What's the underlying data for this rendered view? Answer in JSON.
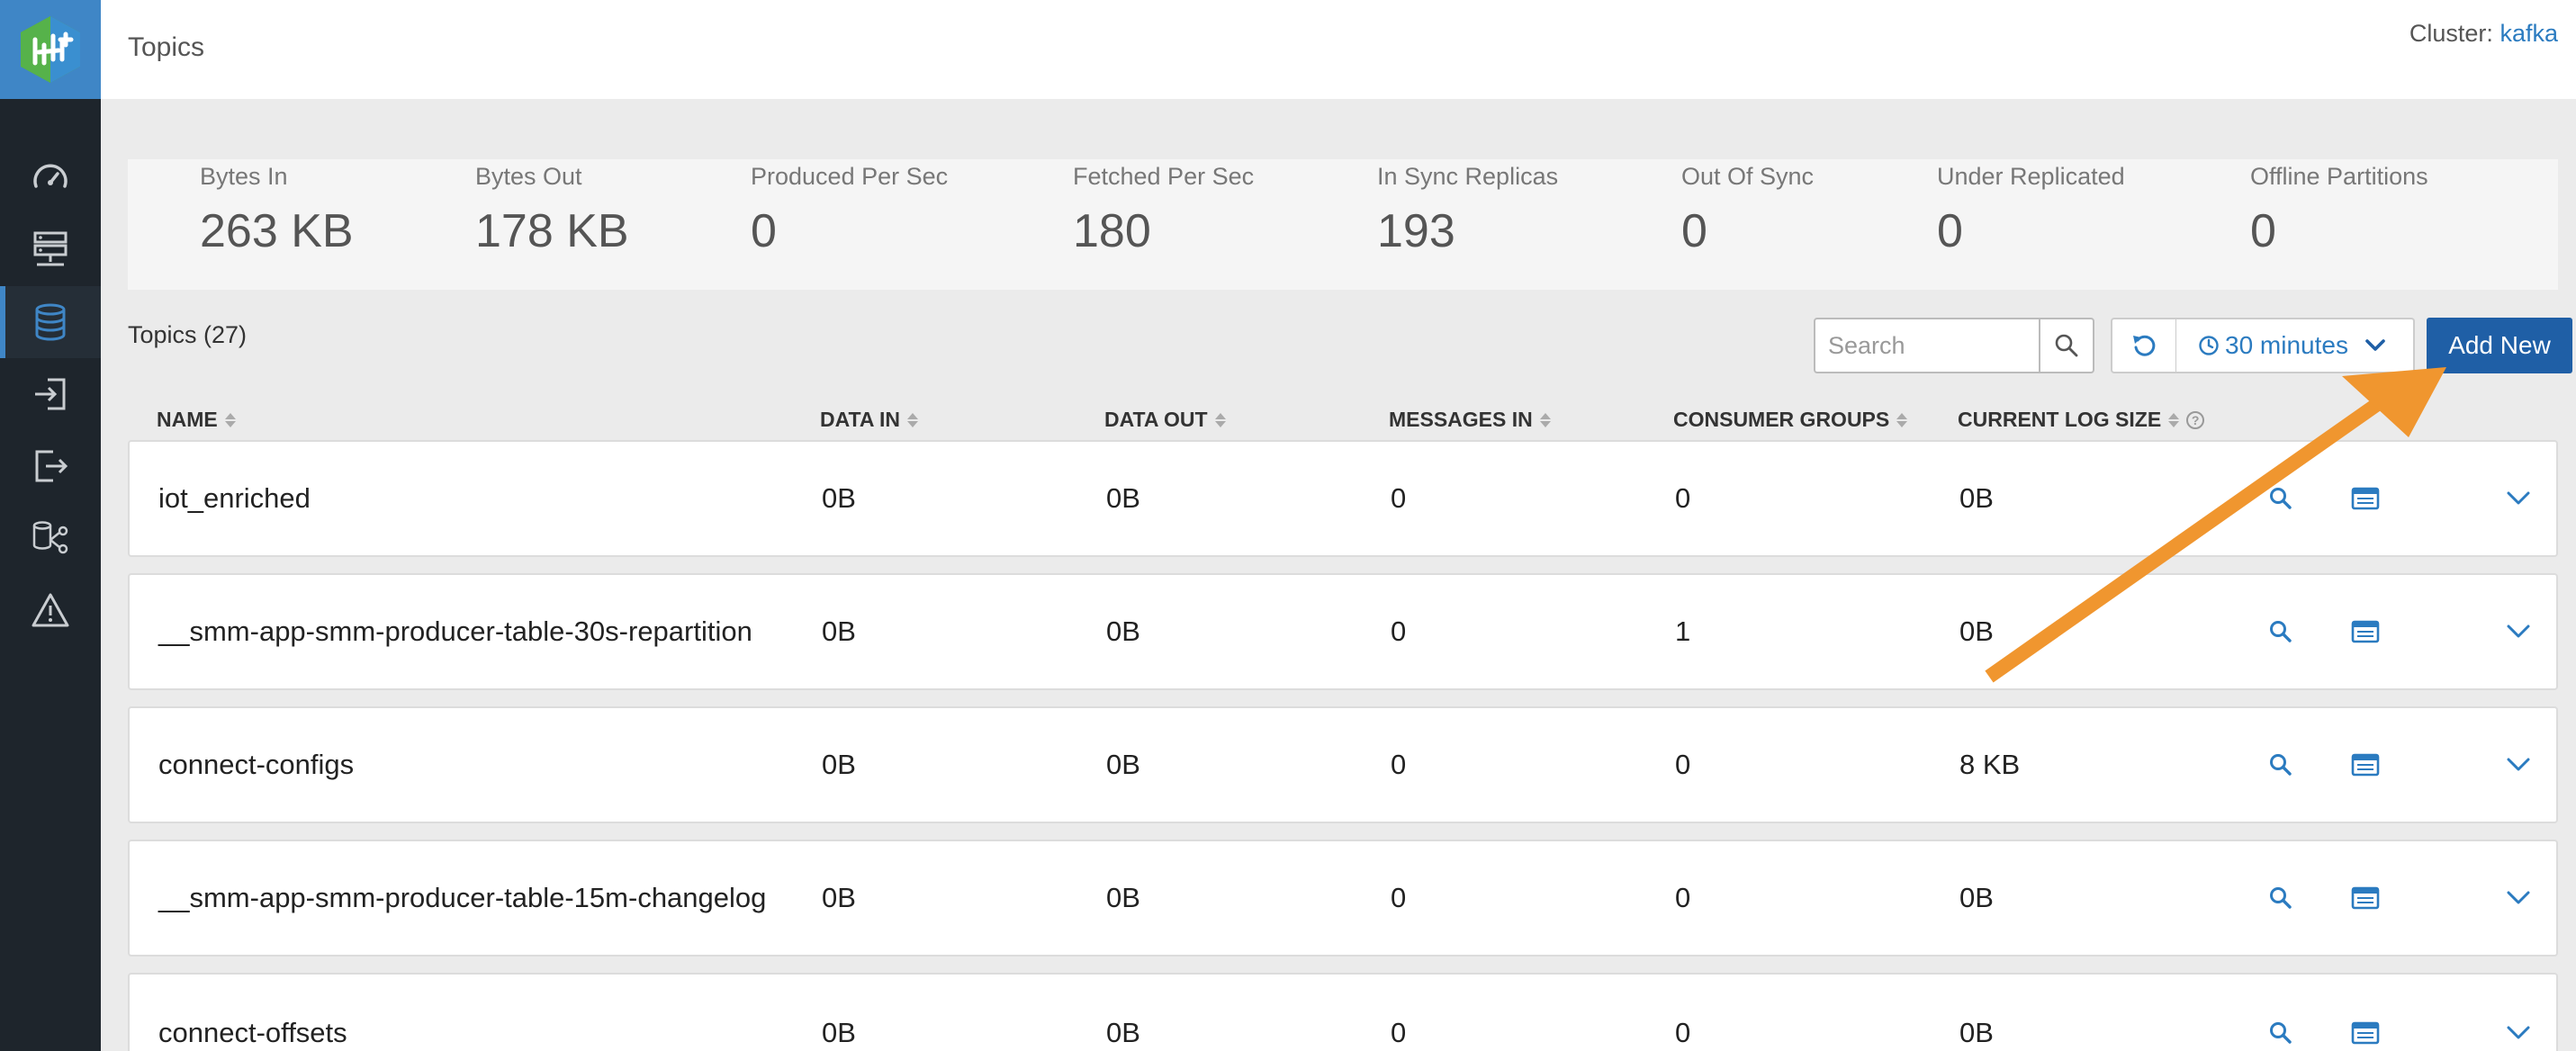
{
  "header": {
    "title": "Topics",
    "cluster_label": "Cluster:",
    "cluster_name": "kafka"
  },
  "sidebar": {
    "items": [
      {
        "icon": "dashboard-gauge-icon",
        "active": false
      },
      {
        "icon": "brokers-server-icon",
        "active": false
      },
      {
        "icon": "topics-database-icon",
        "active": true
      },
      {
        "icon": "producers-login-icon",
        "active": false
      },
      {
        "icon": "consumers-logout-icon",
        "active": false
      },
      {
        "icon": "data-explorer-share-icon",
        "active": false
      },
      {
        "icon": "alerts-warning-icon",
        "active": false
      }
    ]
  },
  "stats": [
    {
      "label": "Bytes In",
      "value": "263 KB"
    },
    {
      "label": "Bytes Out",
      "value": "178 KB"
    },
    {
      "label": "Produced Per Sec",
      "value": "0"
    },
    {
      "label": "Fetched Per Sec",
      "value": "180"
    },
    {
      "label": "In Sync Replicas",
      "value": "193"
    },
    {
      "label": "Out Of Sync",
      "value": "0"
    },
    {
      "label": "Under Replicated",
      "value": "0"
    },
    {
      "label": "Offline Partitions",
      "value": "0"
    }
  ],
  "toolbar": {
    "topics_count": "Topics (27)",
    "search_placeholder": "Search",
    "time_range": "30 minutes",
    "add_new": "Add New"
  },
  "table": {
    "columns": [
      "NAME",
      "DATA IN",
      "DATA OUT",
      "MESSAGES IN",
      "CONSUMER GROUPS",
      "CURRENT LOG SIZE"
    ],
    "rows": [
      {
        "name": "iot_enriched",
        "data_in": "0B",
        "data_out": "0B",
        "messages_in": "0",
        "consumer_groups": "0",
        "log_size": "0B"
      },
      {
        "name": "__smm-app-smm-producer-table-30s-repartition",
        "data_in": "0B",
        "data_out": "0B",
        "messages_in": "0",
        "consumer_groups": "1",
        "log_size": "0B"
      },
      {
        "name": "connect-configs",
        "data_in": "0B",
        "data_out": "0B",
        "messages_in": "0",
        "consumer_groups": "0",
        "log_size": "8 KB"
      },
      {
        "name": "__smm-app-smm-producer-table-15m-changelog",
        "data_in": "0B",
        "data_out": "0B",
        "messages_in": "0",
        "consumer_groups": "0",
        "log_size": "0B"
      },
      {
        "name": "connect-offsets",
        "data_in": "0B",
        "data_out": "0B",
        "messages_in": "0",
        "consumer_groups": "0",
        "log_size": "0B"
      }
    ]
  },
  "colors": {
    "sidebar_bg": "#1e252c",
    "accent_blue": "#2b7bc0",
    "primary_button": "#1f5fa6",
    "annotation_arrow": "#f0962f"
  }
}
